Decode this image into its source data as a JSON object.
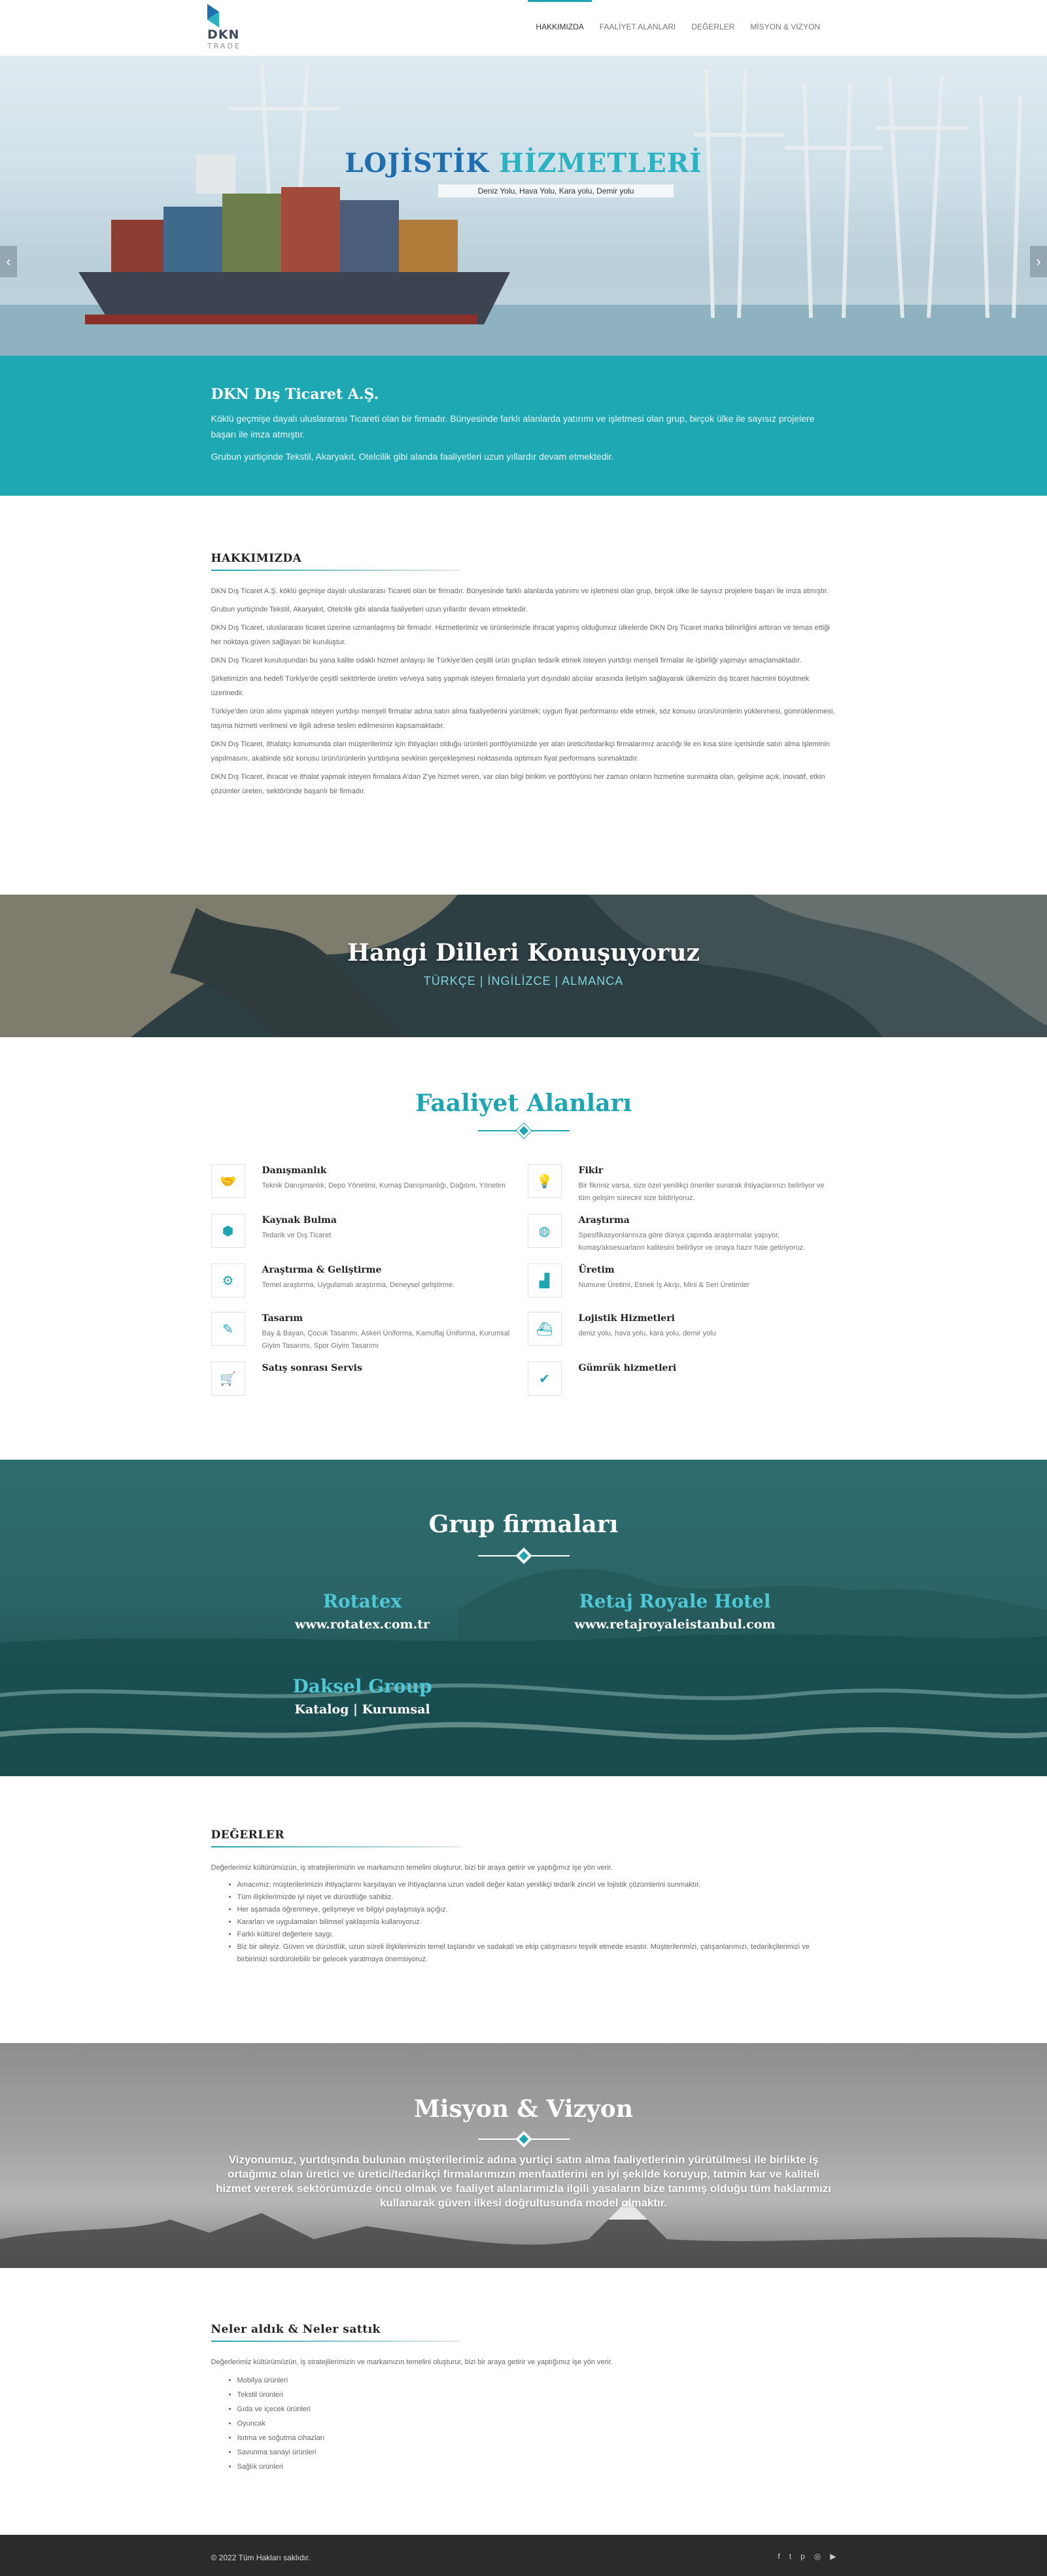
{
  "brand": {
    "line1": "DKN",
    "line2": "TRADE"
  },
  "nav": [
    {
      "label": "HAKKIMIZDA"
    },
    {
      "label": "FAALİYET ALANLARI"
    },
    {
      "label": "DEĞERLER"
    },
    {
      "label": "MİSYON & VİZYON"
    }
  ],
  "hero": {
    "title_a": "LOJİSTİK",
    "title_b": "HİZMETLERİ",
    "subtitle": "Deniz Yolu, Hava Yolu, Kara yolu, Demir yolu",
    "prev": "‹",
    "next": "›"
  },
  "intro": {
    "title": "DKN Dış Ticaret A.Ş.",
    "p1": "Köklü geçmişe dayalı uluslararası Ticareti olan bir firmadır. Bünyesinde farklı alanlarda yatırımı ve işletmesi olan grup, birçok ülke ile sayısız projelere başarı ile imza atmıştır.",
    "p2": "Grubun yurtiçinde Tekstil, Akaryakıt, Otelcilik gibi alanda faaliyetleri uzun yıllardır devam etmektedir."
  },
  "about": {
    "title": "HAKKIMIZDA",
    "paragraphs": [
      "DKN Dış Ticaret A.Ş. köklü geçmişe dayalı uluslararası Ticareti olan bir firmadır. Bünyesinde farklı alanlarda yatırımı ve işletmesi olan grup, birçok ülke ile sayısız projelere başarı ile imza atmıştır.",
      "Grubun yurtiçinde Tekstil, Akaryakıt, Otelcilik gibi alanda faaliyetleri uzun yıllardır devam etmektedir.",
      "DKN Dış Ticaret, uluslararası ticaret üzerine uzmanlaşmış bir firmadır. Hizmetlerimiz ve ürünlerimizle ihracat yapmış olduğumuz ülkelerde DKN Dış Ticaret marka bilinirliğini arttıran ve temas ettiği her noktaya güven sağlayan bir kuruluştur.",
      "DKN Dış Ticaret kuruluşundan bu yana kalite odaklı hizmet anlayışı ile Türkiye'den çeşitli ürün grupları tedarik etmek isteyen yurtdışı menşeli firmalar ile işbirliği yapmayı amaçlamaktadır.",
      "Şirketimizin ana hedefi Türkiye'de çeşitli sektörlerde üretim ve/veya satış yapmak isteyen firmalarla yurt dışındaki alıcılar arasında iletişim sağlayarak ülkemizin dış ticaret hacmini büyütmek üzerinedir.",
      "Türkiye'den ürün alımı yapmak isteyen yurtdışı menşeli firmalar adına satın alma faaliyetlerini yürütmek; uygun fiyat performansı elde etmek, söz konusu ürün/ürünlerin yüklenmesi, gümrüklenmesi, taşıma hizmeti verilmesi ve ilgili adrese teslim edilmesinin kapsamaktadır.",
      "DKN Dış Ticaret, ithalatçı konumunda olan müşterilerimiz için ihtiyaçları olduğu ürünleri portföyümüzde yer alan üretici/tedarikçi firmalarımız aracılığı ile en kısa süre içerisinde satın alma işleminin yapılmasını, akabinde söz konusu ürün/ürünlerin yurtdışına sevkinin gerçekleşmesi noktasında optimum fiyat performans sunmaktadır.",
      "DKN Dış Ticaret, ihracat ve ithalat yapmak isteyen firmalara A'dan Z'ye hizmet veren, var olan bilgi birikim ve portföyünü her zaman onların hizmetine sunmakta olan, gelişime açık, inovatif, etkin çözümler üreten, sektöründe başarılı bir firmadır."
    ]
  },
  "languages": {
    "title": "Hangi Dilleri Konuşuyoruz",
    "list": "TÜRKÇE | İNGİLİZCE | ALMANCA"
  },
  "activities": {
    "title": "Faaliyet Alanları",
    "items": [
      {
        "icon": "handshake-icon",
        "glyph": "🤝",
        "title": "Danışmanlık",
        "desc": "Teknik Danışmanlık, Depo Yönetimi, Kumaş Danışmanlığı, Dağıtım, Yönetim"
      },
      {
        "icon": "lightbulb-icon",
        "glyph": "💡",
        "title": "Fikir",
        "desc": "Bir fikriniz varsa, size özel yenilikçi öneriler sunarak ihtiyaçlarınızı belirliyor ve tüm gelişim sürecini size bildiriyoruz."
      },
      {
        "icon": "cubes-icon",
        "glyph": "⬢",
        "title": "Kaynak Bulma",
        "desc": "Tedarik ve Dış Ticaret"
      },
      {
        "icon": "globe-icon",
        "glyph": "◍",
        "title": "Araştırma",
        "desc": "Spesifikasyonlarınıza göre dünya çapında araştırmalar yapıyor, kumaş/aksesuarların kalitesini belirliyor ve onaya hazır hale getiriyoruz."
      },
      {
        "icon": "cogs-icon",
        "glyph": "⚙",
        "title": "Araştırma & Geliştirme",
        "desc": "Temel araştırma, Uygulamalı araştırma, Deneysel geliştirme."
      },
      {
        "icon": "industry-icon",
        "glyph": "▟",
        "title": "Üretim",
        "desc": "Numune Üretimi, Esnek İş Akışı, Mini & Seri Üretimler"
      },
      {
        "icon": "edit-icon",
        "glyph": "✎",
        "title": "Tasarım",
        "desc": "Bay & Bayan, Çocuk Tasarımı, Askeri Üniforma, Kamuflaj Üniforma, Kurumsal Giyim Tasarımı, Spor Giyim Tasarımı"
      },
      {
        "icon": "ship-icon",
        "glyph": "⛴",
        "title": "Lojistik Hizmetleri",
        "desc": "deniz yolu, hava yolu, kara yolu, demir yolu"
      },
      {
        "icon": "cart-icon",
        "glyph": "🛒",
        "title": "Satış sonrası Servis",
        "desc": ""
      },
      {
        "icon": "check-circle-icon",
        "glyph": "✔",
        "title": "Gümrük hizmetleri",
        "desc": ""
      }
    ]
  },
  "group": {
    "title": "Grup firmaları",
    "companies": [
      {
        "name": "Rotatex",
        "link": "www.rotatex.com.tr"
      },
      {
        "name": "Retaj Royale Hotel",
        "link": "www.retajroyaleistanbul.com"
      },
      {
        "name": "Daksel Group",
        "link": "Katalog | Kurumsal"
      }
    ]
  },
  "values": {
    "title": "DEĞERLER",
    "intro": "Değerlerimiz kültürümüzün, iş stratejilerimizin ve markamızın temelini oluşturur, bizi bir araya getirir ve yaptığımız işe yön verir.",
    "items": [
      "Amacımız; müşterilerimizin ihtiyaçlarını karşılayan ve ihtiyaçlarına uzun vadeli değer katan yenilikçi tedarik zinciri ve lojistik çözümlerini sunmaktır.",
      "Tüm ilişkilerimizde iyi niyet ve dürüstlüğe sahibiz.",
      "Her aşamada öğrenmeye, gelişmeye ve bilgiyi paylaşmaya açığız.",
      "Kararları ve uygulamaları bilimsel yaklaşımla kullanıyoruz.",
      "Farklı kültürel değerlere saygı.",
      "Biz bir aileyiz. Güven ve dürüstlük, uzun süreli ilişkilerimizin temel taşlarıdır ve sadakati ve ekip çalışmasını teşvik etmede esastır. Müşterilerimizi, çalışanlarımızı, tedarikçilerimizi ve birbirimizi sürdürülebilir bir gelecek yaratmaya önemsiyoruz."
    ]
  },
  "mission": {
    "title": "Misyon & Vizyon",
    "text": "Vizyonumuz, yurtdışında bulunan müşterilerimiz adına yurtiçi satın alma faaliyetlerinin yürütülmesi ile birlikte iş ortağımız olan üretici ve üretici/tedarikçi firmalarımızın menfaatlerini en iyi şekilde koruyup, tatmin kar ve kaliteli hizmet vererek sektörümüzde öncü olmak ve faaliyet alanlarımızla ilgili yasaların bize tanımış olduğu tüm haklarımızı kullanarak güven ilkesi doğrultusunda model olmaktır."
  },
  "sold": {
    "title": "Neler aldık & Neler sattık",
    "intro": "Değerlerimiz kültürümüzün, iş stratejilerimizin ve markamızın temelini oluşturur, bizi bir araya getirir ve yaptığımız işe yön verir.",
    "items": [
      "Mobilya ürünleri",
      "Tekstil ürünleri",
      "Gıda ve içecek ürünleri",
      "Oyuncak",
      "Isıtma ve soğutma cihazları",
      "Savunma sanayi ürünleri",
      "Sağlık ürünleri"
    ]
  },
  "footer": {
    "copyright": "© 2022 Tüm Hakları saklıdır.",
    "social": [
      {
        "icon": "facebook-icon",
        "glyph": "f"
      },
      {
        "icon": "twitter-icon",
        "glyph": "t"
      },
      {
        "icon": "pinterest-icon",
        "glyph": "p"
      },
      {
        "icon": "instagram-icon",
        "glyph": "◎"
      },
      {
        "icon": "youtube-icon",
        "glyph": "▶"
      }
    ]
  },
  "colors": {
    "accent": "#1ca6b2",
    "title_blue": "#1f6fb0",
    "footer_bg": "#2b2b2b"
  }
}
